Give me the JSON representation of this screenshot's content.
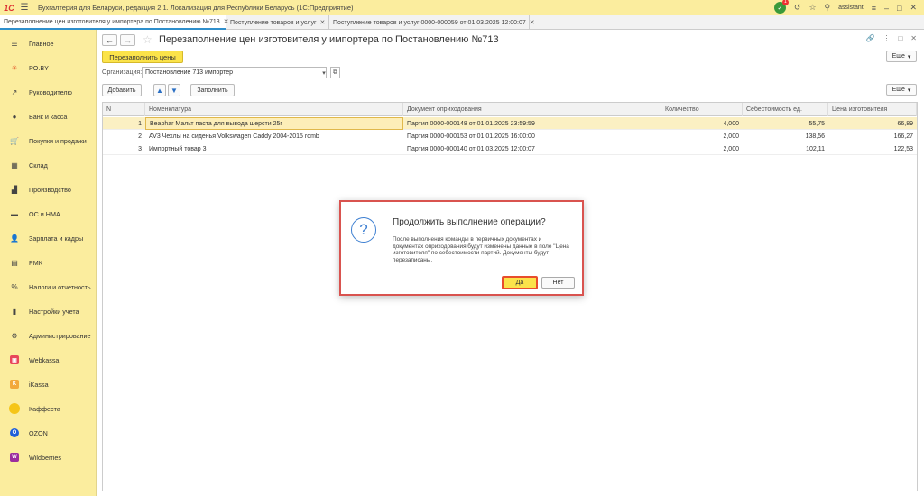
{
  "app": {
    "logo": "1С",
    "title": "Бухгалтерия для Беларуси, редакция 2.1. Локализация для Республики Беларусь   (1С:Предприятие)",
    "user": "assistant",
    "notifications_count": "1"
  },
  "tabs": [
    {
      "label": "Перезаполнение цен изготовителя у импортера по Постановлению №713",
      "active": true
    },
    {
      "label": "Поступление товаров и услуг",
      "active": false
    },
    {
      "label": "Поступление товаров и услуг 0000-000059 от 01.03.2025 12:00:07",
      "active": false
    }
  ],
  "sidebar": {
    "items": [
      {
        "label": "Главное",
        "icon": "menu-icon"
      },
      {
        "label": "PO.BY",
        "icon": "asterisk-icon"
      },
      {
        "label": "Руководителю",
        "icon": "trend-icon"
      },
      {
        "label": "Банк и касса",
        "icon": "coin-icon"
      },
      {
        "label": "Покупки и продажи",
        "icon": "cart-icon"
      },
      {
        "label": "Склад",
        "icon": "warehouse-icon"
      },
      {
        "label": "Производство",
        "icon": "factory-icon"
      },
      {
        "label": "ОС и НМА",
        "icon": "truck-icon"
      },
      {
        "label": "Зарплата и кадры",
        "icon": "person-icon"
      },
      {
        "label": "РМК",
        "icon": "register-icon"
      },
      {
        "label": "Налоги и отчетность",
        "icon": "percent-icon"
      },
      {
        "label": "Настройки учета",
        "icon": "book-icon"
      },
      {
        "label": "Администрирование",
        "icon": "gear-icon"
      },
      {
        "label": "Webkassa",
        "icon": "webkassa-icon"
      },
      {
        "label": "iKassa",
        "icon": "ikassa-icon"
      },
      {
        "label": "Каффеста",
        "icon": "kaffesta-icon"
      },
      {
        "label": "OZON",
        "icon": "ozon-icon"
      },
      {
        "label": "Wildberries",
        "icon": "wildberries-icon"
      }
    ]
  },
  "document": {
    "title": "Перезаполнение цен изготовителя у импортера по Постановлению №713",
    "refill_prices_button": "Перезаполнить цены",
    "more_button": "Еще",
    "organization_label": "Организация:",
    "organization_value": "Постановление 713 импортер",
    "add_button": "Добавить",
    "fill_button": "Заполнить"
  },
  "table": {
    "columns": [
      "N",
      "Номенклатура",
      "Документ оприходования",
      "Количество",
      "Себестоимость ед.",
      "Цена изготовителя"
    ],
    "rows": [
      {
        "n": "1",
        "name": "Beaphar Мальт паста для вывода шерсти 25г",
        "doc": "Партия 0000-000148 от 01.01.2025 23:59:59",
        "qty": "4,000",
        "cost": "55,75",
        "price": "66,89"
      },
      {
        "n": "2",
        "name": "AV3 Чехлы на сиденья Volkswagen Caddy 2004-2015 romb",
        "doc": "Партия 0000-000153 от 01.01.2025 16:00:00",
        "qty": "2,000",
        "cost": "138,56",
        "price": "166,27"
      },
      {
        "n": "3",
        "name": "Импортный товар 3",
        "doc": "Партия 0000-000140 от 01.03.2025 12:00:07",
        "qty": "2,000",
        "cost": "102,11",
        "price": "122,53"
      }
    ]
  },
  "dialog": {
    "title": "Продолжить выполнение операции?",
    "text": "После выполнения команды в первичных документах и документах оприходования будут изменены данные в поле \"Цена изготовителя\" по себестоимости партий. Документы будут перезаписаны.",
    "yes_button": "Да",
    "no_button": "Нет"
  }
}
